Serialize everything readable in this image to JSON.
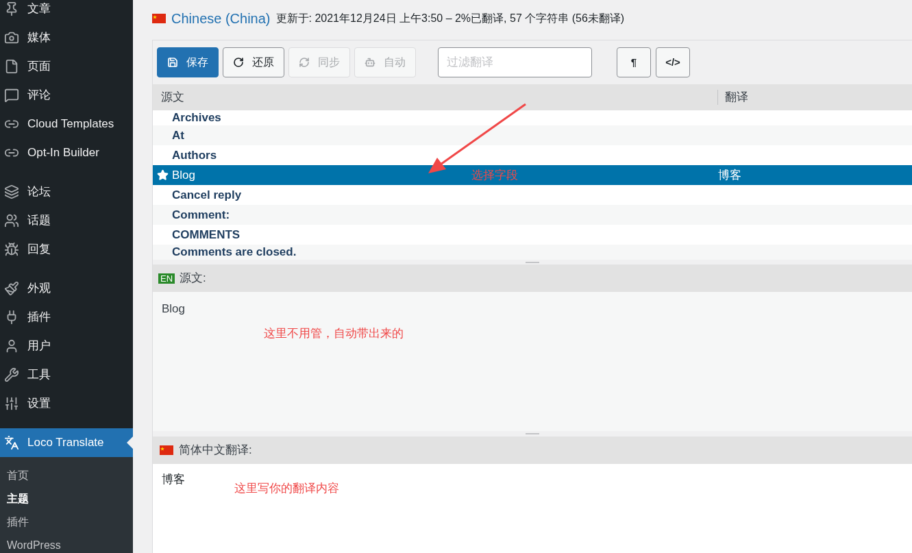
{
  "sidebar": {
    "groups": [
      [
        {
          "label": "文章",
          "selected": false
        },
        {
          "label": "媒体",
          "selected": false
        },
        {
          "label": "页面",
          "selected": false
        },
        {
          "label": "评论",
          "selected": false
        },
        {
          "label": "Cloud Templates",
          "selected": false
        },
        {
          "label": "Opt-In Builder",
          "selected": false
        }
      ],
      [
        {
          "label": "论坛",
          "selected": false
        },
        {
          "label": "话题",
          "selected": false
        },
        {
          "label": "回复",
          "selected": false
        }
      ],
      [
        {
          "label": "外观",
          "selected": false
        },
        {
          "label": "插件",
          "selected": false
        },
        {
          "label": "用户",
          "selected": false
        },
        {
          "label": "工具",
          "selected": false
        },
        {
          "label": "设置",
          "selected": false
        }
      ],
      [
        {
          "label": "Loco Translate",
          "selected": true
        }
      ]
    ],
    "submenu": [
      {
        "label": "首页",
        "selected": false
      },
      {
        "label": "主题",
        "selected": true
      },
      {
        "label": "插件",
        "selected": false
      },
      {
        "label": "WordPress",
        "selected": false
      }
    ]
  },
  "header": {
    "locale": "Chinese (China)",
    "meta": "更新于: 2021年12月24日 上午3:50 – 2%已翻译, 57 个字符串 (56未翻译)"
  },
  "toolbar": {
    "buttons": [
      {
        "label": "保存",
        "kind": "primary",
        "disabled": false
      },
      {
        "label": "还原",
        "kind": "normal",
        "disabled": false
      },
      {
        "label": "同步",
        "kind": "normal",
        "disabled": true
      },
      {
        "label": "自动",
        "kind": "normal",
        "disabled": true
      }
    ],
    "filter": {
      "placeholder": "过滤翻译"
    },
    "tools": [
      "¶",
      "</>"
    ]
  },
  "table": {
    "columns": [
      "源文",
      "翻译"
    ],
    "rows": [
      {
        "source": "Archives",
        "selected": false,
        "starred": false
      },
      {
        "source": "At",
        "selected": false,
        "starred": false
      },
      {
        "source": "Authors",
        "selected": false,
        "starred": false
      },
      {
        "source": "Blog",
        "translation": "博客",
        "selected": true,
        "starred": true
      },
      {
        "source": "Cancel reply",
        "selected": false,
        "starred": false
      },
      {
        "source": "Comment:",
        "selected": false,
        "starred": false
      },
      {
        "source": "COMMENTS",
        "selected": false,
        "starred": false
      },
      {
        "source": "Comments are closed.",
        "selected": false,
        "starred": false
      }
    ]
  },
  "source_pane": {
    "badge": "EN",
    "title": "源文:",
    "text": "Blog"
  },
  "target_pane": {
    "title": "简体中文翻译:",
    "value": "博客"
  },
  "annotations": [
    {
      "text": "选择字段"
    },
    {
      "text": "这里不用管，自动带出来的"
    },
    {
      "text": "这里写你的翻译内容"
    }
  ]
}
